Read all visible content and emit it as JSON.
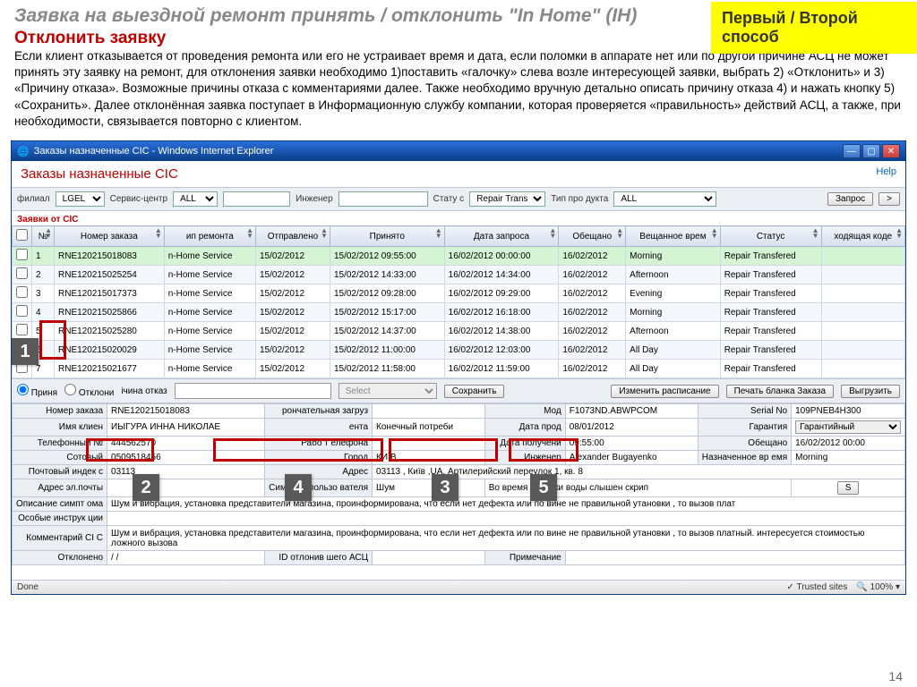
{
  "slide": {
    "title": "Заявка на выездной ремонт принять / отклонить \"In Home\" (IH)",
    "method_badge": "Первый / Второй способ",
    "reject_title": "Отклонить заявку",
    "body": "Если клиент отказывается от проведения ремонта или его не устраивает время и дата,  если поломки в аппарате нет или по другой причине АСЦ не может принять эту заявку на ремонт,  для отклонения заявки необходимо  1)поставить «галочку» слева возле интересующей заявки,  выбрать 2) «Отклонить»  и 3) «Причину отказа». Возможные причины отказа с комментариями далее. Также необходимо вручную детально описать причину отказа 4) и нажать кнопку  5) «Сохранить». Далее отклонённая заявка поступает в Информационную службу компании, которая проверяется «правильность» действий АСЦ, а также, при необходимости, связывается повторно  с клиентом.",
    "page_number": "14"
  },
  "ie": {
    "title": "Заказы назначенные CIC - Windows Internet Explorer",
    "status_done": "Done",
    "trusted": "Trusted sites",
    "zoom": "100%"
  },
  "page": {
    "title": "Заказы назначенные CIC",
    "help": "Help"
  },
  "filters": {
    "filial_label": "филиал",
    "filial_value": "LGEL",
    "service_label": "Сервис-центр",
    "service_value": "ALL",
    "engineer_label": "Инженер",
    "status_label": "Стату с",
    "status_value": "Repair Transf",
    "product_label": "Тип про дукта",
    "product_value": "ALL",
    "request_btn": "Запрос",
    "arrow_btn": ">"
  },
  "table": {
    "cic_label": "Заявки от CIC",
    "headers": {
      "num": "№",
      "order": "Номер заказа",
      "type": "ип ремонта",
      "sent": "Отправлено",
      "accepted": "Принято",
      "req_date": "Дата запроса",
      "promised": "Обещано",
      "prom_time": "Вещанное врем",
      "status": "Статус",
      "code": "ходящая коде"
    },
    "rows": [
      {
        "n": "1",
        "order": "RNE120215018083",
        "type": "n-Home Service",
        "sent": "15/02/2012",
        "acc": "15/02/2012 09:55:00",
        "req": "16/02/2012 00:00:00",
        "prom": "16/02/2012",
        "time": "Morning",
        "status": "Repair Transfered"
      },
      {
        "n": "2",
        "order": "RNE120215025254",
        "type": "n-Home Service",
        "sent": "15/02/2012",
        "acc": "15/02/2012 14:33:00",
        "req": "16/02/2012 14:34:00",
        "prom": "16/02/2012",
        "time": "Afternoon",
        "status": "Repair Transfered"
      },
      {
        "n": "3",
        "order": "RNE120215017373",
        "type": "n-Home Service",
        "sent": "15/02/2012",
        "acc": "15/02/2012 09:28:00",
        "req": "16/02/2012 09:29:00",
        "prom": "16/02/2012",
        "time": "Evening",
        "status": "Repair Transfered"
      },
      {
        "n": "4",
        "order": "RNE120215025866",
        "type": "n-Home Service",
        "sent": "15/02/2012",
        "acc": "15/02/2012 15:17:00",
        "req": "16/02/2012 16:18:00",
        "prom": "16/02/2012",
        "time": "Morning",
        "status": "Repair Transfered"
      },
      {
        "n": "5",
        "order": "RNE120215025280",
        "type": "n-Home Service",
        "sent": "15/02/2012",
        "acc": "15/02/2012 14:37:00",
        "req": "16/02/2012 14:38:00",
        "prom": "16/02/2012",
        "time": "Afternoon",
        "status": "Repair Transfered"
      },
      {
        "n": "6",
        "order": "RNE120215020029",
        "type": "n-Home Service",
        "sent": "15/02/2012",
        "acc": "15/02/2012 11:00:00",
        "req": "16/02/2012 12:03:00",
        "prom": "16/02/2012",
        "time": "All Day",
        "status": "Repair Transfered"
      },
      {
        "n": "7",
        "order": "RNE120215021677",
        "type": "n-Home Service",
        "sent": "15/02/2012",
        "acc": "15/02/2012 11:58:00",
        "req": "16/02/2012 11:59:00",
        "prom": "16/02/2012",
        "time": "All Day",
        "status": "Repair Transfered"
      }
    ]
  },
  "actions": {
    "accept": "Приня",
    "reject": "Отклони",
    "reason_label": "ічина отказ",
    "select_placeholder": "Select",
    "save": "Сохранить",
    "schedule": "Изменить расписание",
    "print": "Печать бланка Заказа",
    "export": "Выгрузить"
  },
  "detail": {
    "order_no_label": "Номер заказа",
    "order_no": "RNE120215018083",
    "client_name_label": "Имя клиен",
    "client_name": "ИЫГУРА ИННА  НИКОЛАЕ",
    "phone_label": "Телефонный №",
    "phone": "444562570",
    "mobile_label": "Сотовый",
    "mobile": "0509518456",
    "postal_label": "Почтовый индек с",
    "postal": "03113",
    "email_label": "Адрес эл.почты",
    "symptom_desc_label": "Описание симпт ома",
    "symptom_desc": "Шум и вибрация, установка представители магазина, проинформирована, что если нет дефекта или по вине не правильной утановки , то вызов плат",
    "instr_label": "Особые инструк ции",
    "cic_comment_label": "Комментарий CI C",
    "cic_comment": "Шум и вибрация, установка представители магазина, проинформирована, что если нет дефекта или по вине не правильной утановки , то вызов платный. интересуется стоимостью ложного вызова",
    "rejected_label": "Отклонено",
    "rejected": "/ /",
    "reject_id_label": "ID отлонив шего АСЦ",
    "final_label": "рончательная загруз",
    "repair_type_label": "ента",
    "repair_type": "Конечный потреби",
    "work_phone_label": "Рабо т елефона",
    "city_label": "Город",
    "city": "КИЇВ",
    "address_label": "Адрес",
    "address": "03113 , Київ ,UA, Артилерийский переулок 1, кв. 8",
    "user_symptom_label": "Симптом пользо вателя",
    "user_symptom": "Шум",
    "note_label": "Примечание",
    "model_label": "Мод",
    "model": "F1073ND.ABWPCOM",
    "sale_date_label": "Дата прод",
    "receive_date_label": "Дата получени",
    "receive_date": "08/01/2012",
    "engineer_label": "Инженер",
    "engineer": "Alexander Bugayenko",
    "water_note": "Во время заливки воды слышен скрип",
    "serial_label": "Serial No",
    "serial": "109PNEB4H300",
    "warranty_label": "Гарантия",
    "warranty": "Гарантийный",
    "promised_label": "Обещано",
    "promised": "16/02/2012 00:00",
    "prom_time_label": "Назначенное вр емя",
    "prom_time": "Morning",
    "date2": "09:55:00",
    "s_btn": "S"
  },
  "callouts": {
    "c1": "1",
    "c2": "2",
    "c3": "3",
    "c4": "4",
    "c5": "5"
  }
}
